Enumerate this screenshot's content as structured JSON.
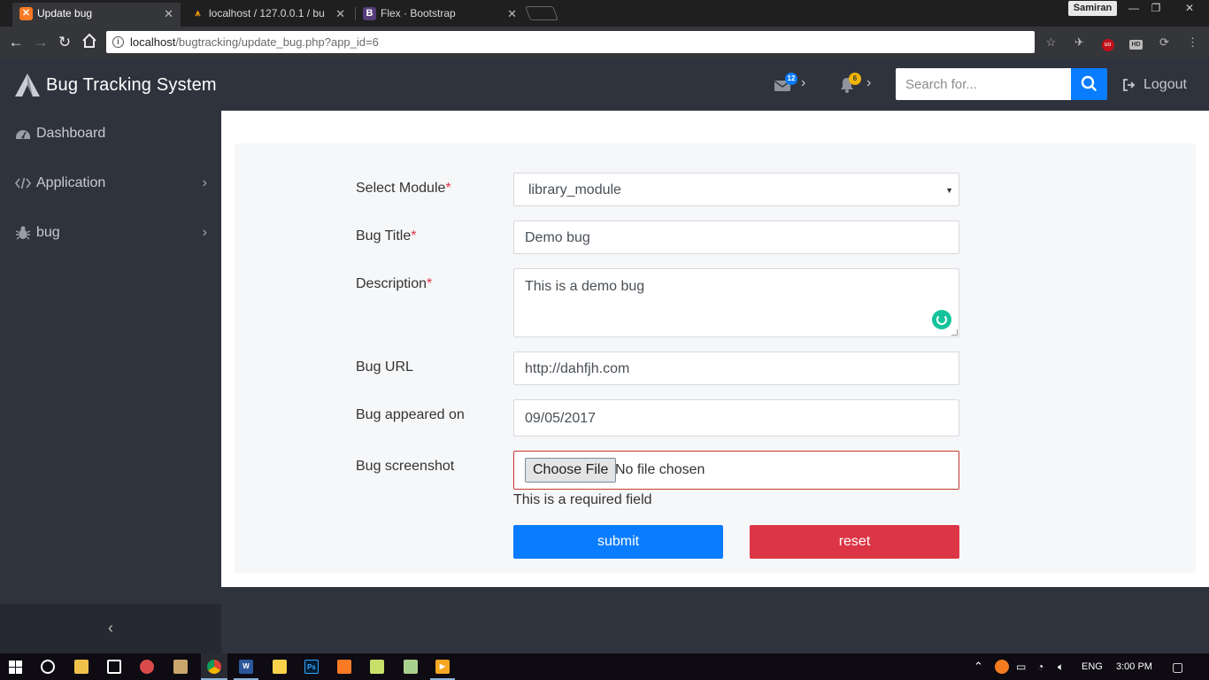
{
  "browser": {
    "tabs": [
      {
        "title": "Update bug",
        "favicon": "xampp-icon",
        "favicon_color": "#fb7a24",
        "active": true
      },
      {
        "title": "localhost / 127.0.0.1 / bu",
        "favicon": "phpmyadmin-icon",
        "favicon_color": "#f89c0e",
        "active": false
      },
      {
        "title": "Flex · Bootstrap",
        "favicon": "bootstrap-icon",
        "favicon_color": "#563d7c",
        "active": false
      }
    ],
    "profile_name": "Samiran",
    "window_buttons": {
      "minimize": "—",
      "restore": "❐",
      "close": "✕"
    },
    "url": {
      "host": "localhost",
      "path": "/bugtracking/update_bug.php?app_id=6"
    }
  },
  "header": {
    "brand": "Bug Tracking System",
    "messages_count": "12",
    "notifications_count": "6",
    "search_placeholder": "Search for...",
    "logout_label": "Logout"
  },
  "sidebar": {
    "items": [
      {
        "label": "Dashboard",
        "icon": "dashboard-icon"
      },
      {
        "label": "Application",
        "icon": "code-icon"
      },
      {
        "label": "bug",
        "icon": "bug-icon"
      }
    ]
  },
  "form": {
    "module_label": "Select Module",
    "module_value": "library_module",
    "title_label": "Bug Title",
    "title_value": "Demo bug",
    "description_label": "Description",
    "description_value": "This is a demo bug",
    "url_label": "Bug URL",
    "url_value": "http://dahfjh.com",
    "date_label": "Bug appeared on",
    "date_value": "09/05/2017",
    "screenshot_label": "Bug screenshot",
    "choose_file_label": "Choose File",
    "no_file_text": "No file chosen",
    "error_text": "This is a required field",
    "required_mark": "*",
    "submit_label": "submit",
    "reset_label": "reset"
  },
  "taskbar": {
    "language": "ENG",
    "time": "3:00 PM"
  },
  "colors": {
    "primary": "#0a7cff",
    "danger": "#dc3545",
    "sidebar_bg": "#2f333e",
    "card_bg": "#f6f7f9"
  }
}
